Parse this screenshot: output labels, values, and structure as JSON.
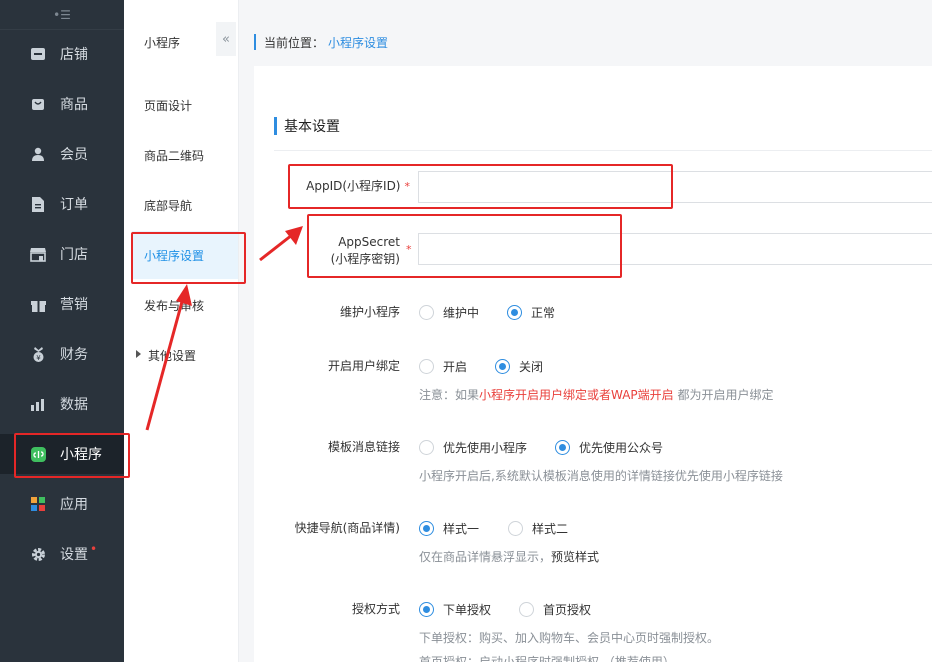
{
  "sidebar": {
    "toggle_glyph": "•☰",
    "items": [
      {
        "label": "店铺",
        "icon": "store-icon"
      },
      {
        "label": "商品",
        "icon": "bag-icon"
      },
      {
        "label": "会员",
        "icon": "user-icon"
      },
      {
        "label": "订单",
        "icon": "order-icon"
      },
      {
        "label": "门店",
        "icon": "shop-icon"
      },
      {
        "label": "营销",
        "icon": "gift-icon"
      },
      {
        "label": "财务",
        "icon": "money-icon"
      },
      {
        "label": "数据",
        "icon": "chart-icon"
      },
      {
        "label": "小程序",
        "icon": "miniprogram-icon"
      },
      {
        "label": "应用",
        "icon": "apps-icon"
      },
      {
        "label": "设置",
        "icon": "gear-icon",
        "dot": "•"
      }
    ]
  },
  "submenu": {
    "title": "小程序",
    "collapse_glyph": "«",
    "items": [
      "页面设计",
      "商品二维码",
      "底部导航",
      "小程序设置",
      "发布与审核",
      "其他设置"
    ]
  },
  "breadcrumb": {
    "prefix": "当前位置：",
    "current": "小程序设置"
  },
  "form": {
    "section_title": "基本设置",
    "appid_label": "AppID(小程序ID)",
    "appid_value": "",
    "secret_label_1": "AppSecret",
    "secret_label_2": "(小程序密钥)",
    "secret_value": "",
    "required_mark": "*",
    "maintain": {
      "label": "维护小程序",
      "opt1": "维护中",
      "opt2": "正常"
    },
    "bind": {
      "label": "开启用户绑定",
      "opt1": "开启",
      "opt2": "关闭",
      "hint_a": "注意：如果",
      "hint_b": "小程序开启用户绑定或者WAP端开启",
      "hint_c": " 都为开启用户绑定"
    },
    "template": {
      "label": "模板消息链接",
      "opt1": "优先使用小程序",
      "opt2": "优先使用公众号",
      "hint": "小程序开启后,系统默认模板消息使用的详情链接优先使用小程序链接"
    },
    "quicknav": {
      "label": "快捷导航(商品详情)",
      "opt1": "样式一",
      "opt2": "样式二",
      "hint_a": "仅在商品详情悬浮显示，",
      "hint_b": "预览样式"
    },
    "auth": {
      "label": "授权方式",
      "opt1": "下单授权",
      "opt2": "首页授权",
      "hint1": "下单授权：购买、加入购物车、会员中心页时强制授权。",
      "hint2": "首页授权：启动小程序时强制授权 （推荐使用）"
    }
  },
  "colors": {
    "accent": "#2e8de0",
    "highlight": "#e52727",
    "sidebar_bg": "#2a333c"
  }
}
